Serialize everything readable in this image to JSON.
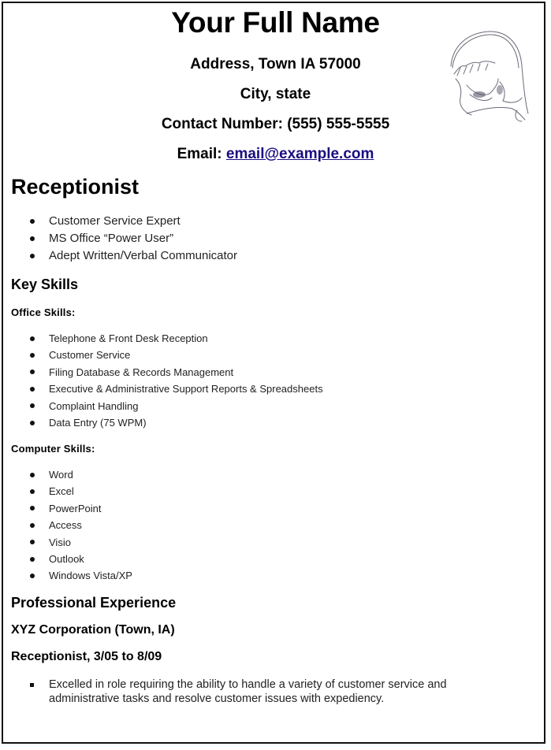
{
  "header": {
    "name": "Your Full Name",
    "address": "Address, Town IA 57000",
    "city_state": "City, state",
    "contact": "Contact Number: (555) 555-5555",
    "email_label": "Email:",
    "email": "email@example.com",
    "photo_icon": "sketch-portrait-icon"
  },
  "objective": {
    "title": "Receptionist",
    "items": [
      "Customer Service Expert",
      "MS Office “Power User”",
      "Adept Written/Verbal Communicator"
    ]
  },
  "key_skills": {
    "title": "Key Skills",
    "office": {
      "label": "Office Skills:",
      "items": [
        "Telephone & Front Desk Reception",
        "Customer Service",
        "Filing Database & Records Management",
        "Executive & Administrative Support Reports & Spreadsheets",
        "Complaint Handling",
        "Data Entry (75 WPM)"
      ]
    },
    "computer": {
      "label": "Computer Skills:",
      "items": [
        "Word",
        "Excel",
        "PowerPoint",
        "Access",
        "Visio",
        "Outlook",
        "Windows Vista/XP"
      ]
    }
  },
  "experience": {
    "title": "Professional Experience",
    "company": "XYZ Corporation (Town, IA)",
    "role": "Receptionist, 3/05 to 8/09",
    "items": [
      "Excelled in role requiring the ability to handle a variety of customer service and administrative tasks and resolve customer issues with expediency."
    ]
  },
  "colors": {
    "link": "#1a0d80",
    "border": "#111111"
  }
}
